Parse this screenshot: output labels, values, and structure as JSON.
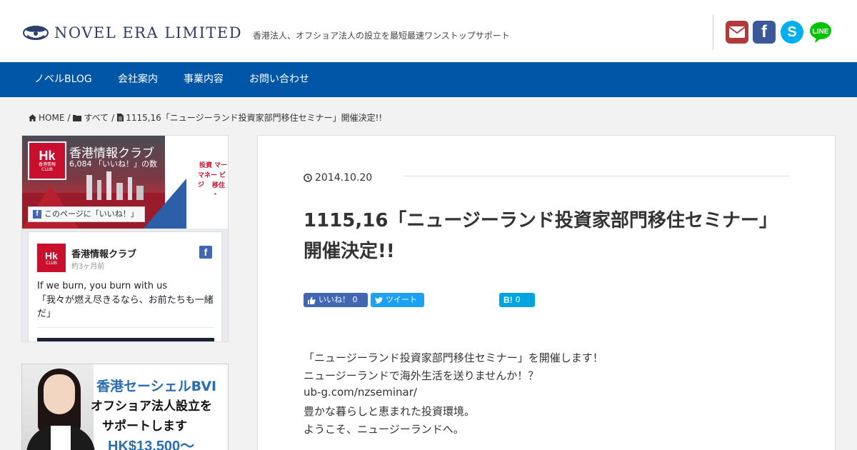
{
  "header": {
    "logo_text": "NOVEL ERA LIMITED",
    "tagline": "香港法人、オフショア法人の設立を最短最速ワンストップサポート",
    "social": [
      "envelope-icon",
      "facebook-icon",
      "skype-icon",
      "line-icon"
    ],
    "line_label": "LINE"
  },
  "nav": {
    "items": [
      {
        "label": "ノベルBLOG"
      },
      {
        "label": "会社案内"
      },
      {
        "label": "事業内容"
      },
      {
        "label": "お問い合わせ"
      }
    ]
  },
  "breadcrumb": {
    "home": "HOME",
    "category": "すべて",
    "current": "1115,16「ニュージーランド投資家部門移住セミナー」開催決定!!",
    "sep": "/"
  },
  "fb_widget": {
    "page_name": "香港情報クラブ",
    "like_count": "6,084 「いいね！」の数",
    "like_button": "このページに「いいね！」",
    "post_name": "香港情報クラブ",
    "post_time": "約3ヶ月前",
    "post_text_1": "If we burn, you burn with us",
    "post_text_2": "「我々が燃え尽きるなら、お前たちも一緒だ」",
    "logo_big": "Hk",
    "logo_small_1": "香港情報",
    "logo_small_2": "CLUB",
    "cover_text": [
      "投資 マー",
      "マネー ビジ",
      "移住 ・"
    ]
  },
  "banner": {
    "line1": "香港セーシェルBVI",
    "line2": "オフショア法人設立を",
    "line3": "サポートします",
    "line4": "HK$13,500〜"
  },
  "article": {
    "date": "2014.10.20",
    "title": "1115,16「ニュージーランド投資家部門移住セミナー」開催決定!!",
    "share": {
      "fb_label": "いいね！ 0",
      "tw_label": "ツイート",
      "hb_label": "B!",
      "hb_count": "0"
    },
    "body": [
      "「ニュージーランド投資家部門移住セミナー」を開催します！",
      "ニュージーランドで海外生活を送りませんか！？",
      "ub-g.com/nzseminar/",
      "豊かな暮らしと恵まれた投資環境。",
      "ようこそ、ニュージーランドへ。"
    ]
  },
  "colors": {
    "nav_bg": "#0056a6",
    "mail_red": "#b13a3a",
    "facebook_blue": "#3b5998",
    "skype_blue": "#00aff0",
    "line_green": "#00c300"
  }
}
